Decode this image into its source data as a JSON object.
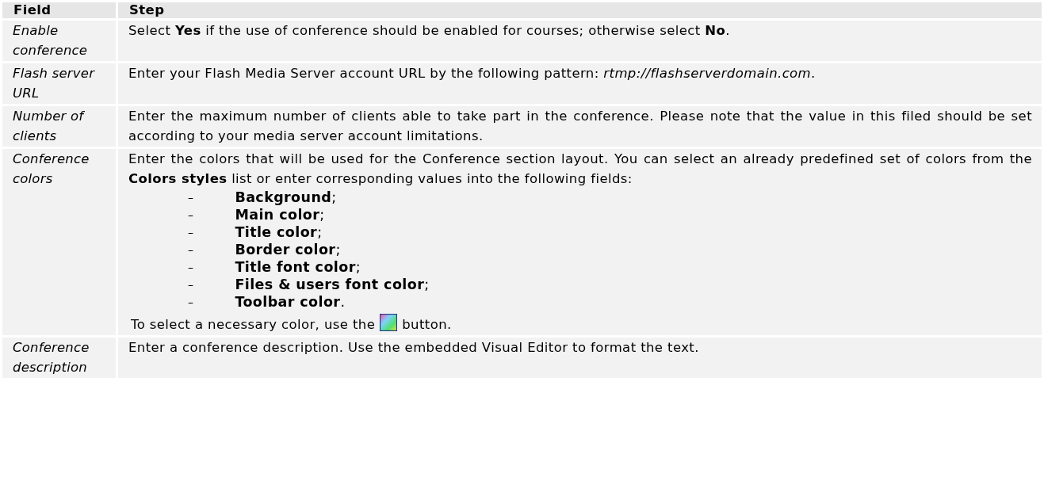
{
  "table": {
    "columns": [
      "Field",
      "Step"
    ],
    "rows": [
      {
        "field": "Enable conference",
        "step": "Select **Yes** if the use of conference should be enabled for courses; otherwise select **No**."
      },
      {
        "field": "Flash server URL",
        "step": "Enter your Flash Media Server account URL by the following pattern: *rtmp://flashserverdomain.com*."
      },
      {
        "field": "Number of clients",
        "step": "Enter the maximum number of clients able to take part in the conference. Please note that the value in this filed should be set according to your media server account limitations."
      },
      {
        "field": "Conference colors",
        "step": "Enter the colors that will be used for the Conference section layout. You can select an already predefined set of colors from the **Colors styles** list or enter corresponding values into the following fields:",
        "list": [
          {
            "bullet": "–",
            "text": "**Background**;"
          },
          {
            "bullet": "–",
            "text": "**Main color**;"
          },
          {
            "bullet": "–",
            "text": "**Title color**;"
          },
          {
            "bullet": "–",
            "text": "**Border color**;"
          },
          {
            "bullet": "–",
            "text": "**Title font color**;"
          },
          {
            "bullet": "–",
            "text": "**Files & users font color**;"
          },
          {
            "bullet": "–",
            "text": "**Toolbar color**."
          }
        ],
        "note_before": "To select a necessary color, use the",
        "note_after": "button."
      },
      {
        "field": "Conference description",
        "step": "Enter a conference description. Use the embedded Visual Editor to format the text."
      }
    ]
  }
}
